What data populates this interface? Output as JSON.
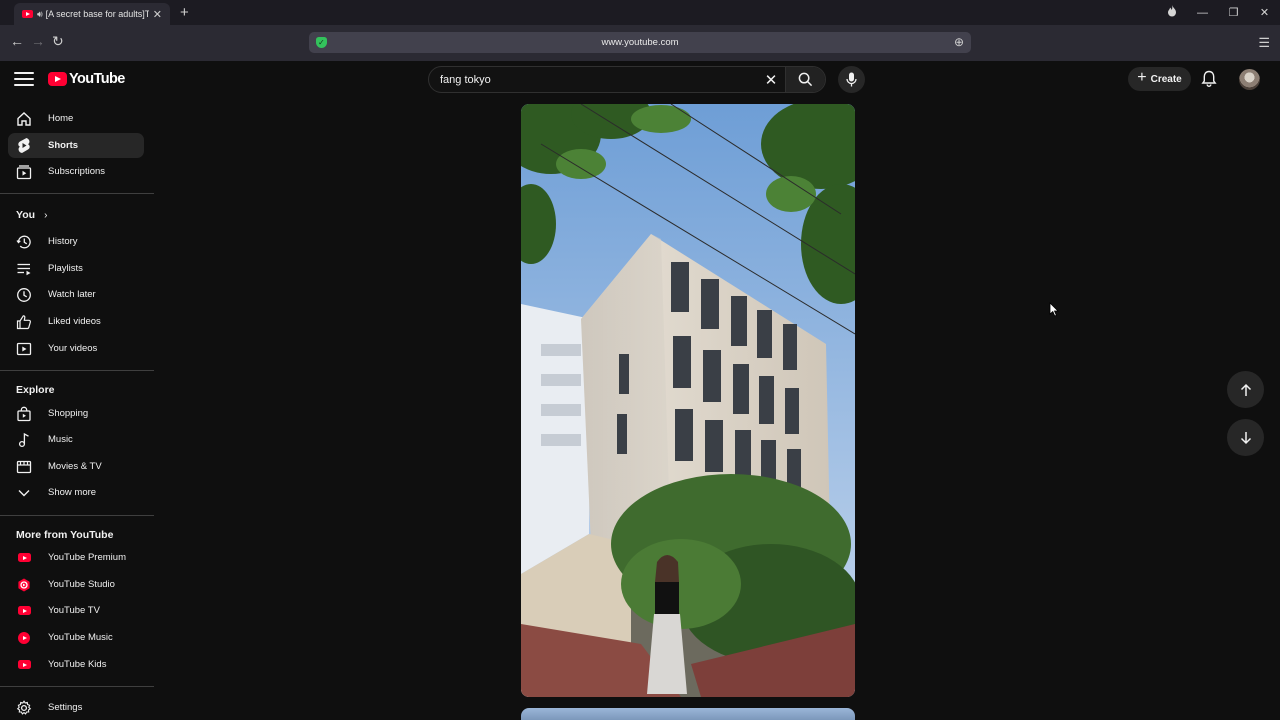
{
  "browser": {
    "tab_title": "[A secret base for adults]T",
    "url": "www.youtube.com"
  },
  "header": {
    "logo_text": "YouTube",
    "search_value": "fang tokyo",
    "search_placeholder": "Search",
    "create_label": "Create"
  },
  "sidebar": {
    "main": [
      {
        "label": "Home",
        "icon": "home-icon"
      },
      {
        "label": "Shorts",
        "icon": "shorts-icon",
        "active": true
      },
      {
        "label": "Subscriptions",
        "icon": "subscriptions-icon"
      }
    ],
    "you_heading": "You",
    "you": [
      {
        "label": "History",
        "icon": "history-icon"
      },
      {
        "label": "Playlists",
        "icon": "playlists-icon"
      },
      {
        "label": "Watch later",
        "icon": "clock-icon"
      },
      {
        "label": "Liked videos",
        "icon": "thumbs-up-icon"
      },
      {
        "label": "Your videos",
        "icon": "your-videos-icon"
      }
    ],
    "explore_heading": "Explore",
    "explore": [
      {
        "label": "Shopping",
        "icon": "shopping-bag-icon"
      },
      {
        "label": "Music",
        "icon": "music-note-icon"
      },
      {
        "label": "Movies & TV",
        "icon": "film-icon"
      },
      {
        "label": "Show more",
        "icon": "chevron-down-icon"
      }
    ],
    "more_heading": "More from YouTube",
    "more": [
      {
        "label": "YouTube Premium",
        "icon": "youtube-premium-icon"
      },
      {
        "label": "YouTube Studio",
        "icon": "youtube-studio-icon"
      },
      {
        "label": "YouTube TV",
        "icon": "youtube-tv-icon"
      },
      {
        "label": "YouTube Music",
        "icon": "youtube-music-icon"
      },
      {
        "label": "YouTube Kids",
        "icon": "youtube-kids-icon"
      }
    ],
    "settings": {
      "label": "Settings",
      "icon": "gear-icon"
    }
  },
  "colors": {
    "background": "#0f0f0f",
    "accent": "#ff0033",
    "active_item": "#272727"
  }
}
